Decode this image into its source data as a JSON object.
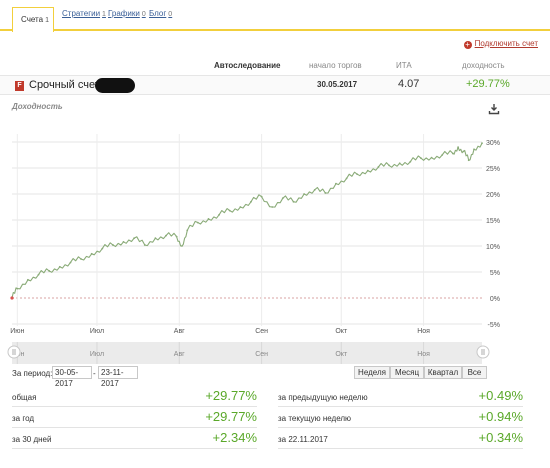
{
  "tabs": [
    {
      "label": "Счета",
      "count": "1"
    },
    {
      "label": "Стратегии",
      "count": "1"
    },
    {
      "label": "Графики",
      "count": "0"
    },
    {
      "label": "Блог",
      "count": "0"
    }
  ],
  "connect_label": "Подключить счет",
  "account_header": {
    "autofollow": "Автоследование",
    "start": "начало торгов",
    "ita": "ИТА",
    "yield": "доходность"
  },
  "account": {
    "broker_icon": "F",
    "name": "Срочный счет",
    "start_date": "30.05.2017",
    "ita": "4.07",
    "yield": "+29.77%"
  },
  "chart_title": "Доходность",
  "icons": {
    "download": "download-icon",
    "connect": "plus-circle-icon",
    "scroll_handle": "scroll-handle-icon"
  },
  "colors": {
    "line": "#8aab78",
    "positive": "#5aa829",
    "tab_accent": "#f2cf3c",
    "link_red": "#b03a2e"
  },
  "chart_data": {
    "type": "line",
    "ylabel": "",
    "ylim": [
      -5,
      30
    ],
    "yticks": [
      "30%",
      "25%",
      "20%",
      "15%",
      "10%",
      "5%",
      "0%",
      "-5%"
    ],
    "months": [
      "Июн",
      "Июл",
      "Авг",
      "Сен",
      "Окт",
      "Ноя"
    ],
    "x": [
      "2017-05-30",
      "2017-06-01",
      "2017-06-05",
      "2017-06-09",
      "2017-06-13",
      "2017-06-17",
      "2017-06-21",
      "2017-06-25",
      "2017-06-29",
      "2017-07-03",
      "2017-07-07",
      "2017-07-11",
      "2017-07-15",
      "2017-07-19",
      "2017-07-23",
      "2017-07-27",
      "2017-07-31",
      "2017-08-02",
      "2017-08-04",
      "2017-08-08",
      "2017-08-12",
      "2017-08-16",
      "2017-08-20",
      "2017-08-24",
      "2017-08-28",
      "2017-09-01",
      "2017-09-05",
      "2017-09-09",
      "2017-09-13",
      "2017-09-17",
      "2017-09-21",
      "2017-09-25",
      "2017-09-29",
      "2017-10-03",
      "2017-10-07",
      "2017-10-11",
      "2017-10-15",
      "2017-10-19",
      "2017-10-23",
      "2017-10-27",
      "2017-10-31",
      "2017-11-04",
      "2017-11-08",
      "2017-11-12",
      "2017-11-14",
      "2017-11-16",
      "2017-11-18",
      "2017-11-20",
      "2017-11-23"
    ],
    "values": [
      0.0,
      1.8,
      3.5,
      4.5,
      5.2,
      6.0,
      6.8,
      7.5,
      8.5,
      9.5,
      10.2,
      10.8,
      11.5,
      10.2,
      11.5,
      12.0,
      11.8,
      10.0,
      13.0,
      14.5,
      15.2,
      16.0,
      16.8,
      17.5,
      18.5,
      19.5,
      17.5,
      19.2,
      18.5,
      20.0,
      20.8,
      20.2,
      22.0,
      23.0,
      23.8,
      24.5,
      25.2,
      25.5,
      25.9,
      26.2,
      26.9,
      27.0,
      27.5,
      27.8,
      29.0,
      28.2,
      26.5,
      28.6,
      29.77
    ]
  },
  "period": {
    "label": "За период:",
    "from": "30-05-2017",
    "to": "23-11-2017",
    "separator": "-",
    "buttons": [
      "Неделя",
      "Месяц",
      "Квартал",
      "Все"
    ]
  },
  "stats_left": [
    {
      "label": "общая",
      "value": "+29.77%"
    },
    {
      "label": "за год",
      "value": "+29.77%"
    },
    {
      "label": "за 30 дней",
      "value": "+2.34%"
    }
  ],
  "stats_right": [
    {
      "label": "за предыдущую неделю",
      "value": "+0.49%"
    },
    {
      "label": "за текущую неделю",
      "value": "+0.94%"
    },
    {
      "label": "за 22.11.2017",
      "value": "+0.34%"
    }
  ]
}
